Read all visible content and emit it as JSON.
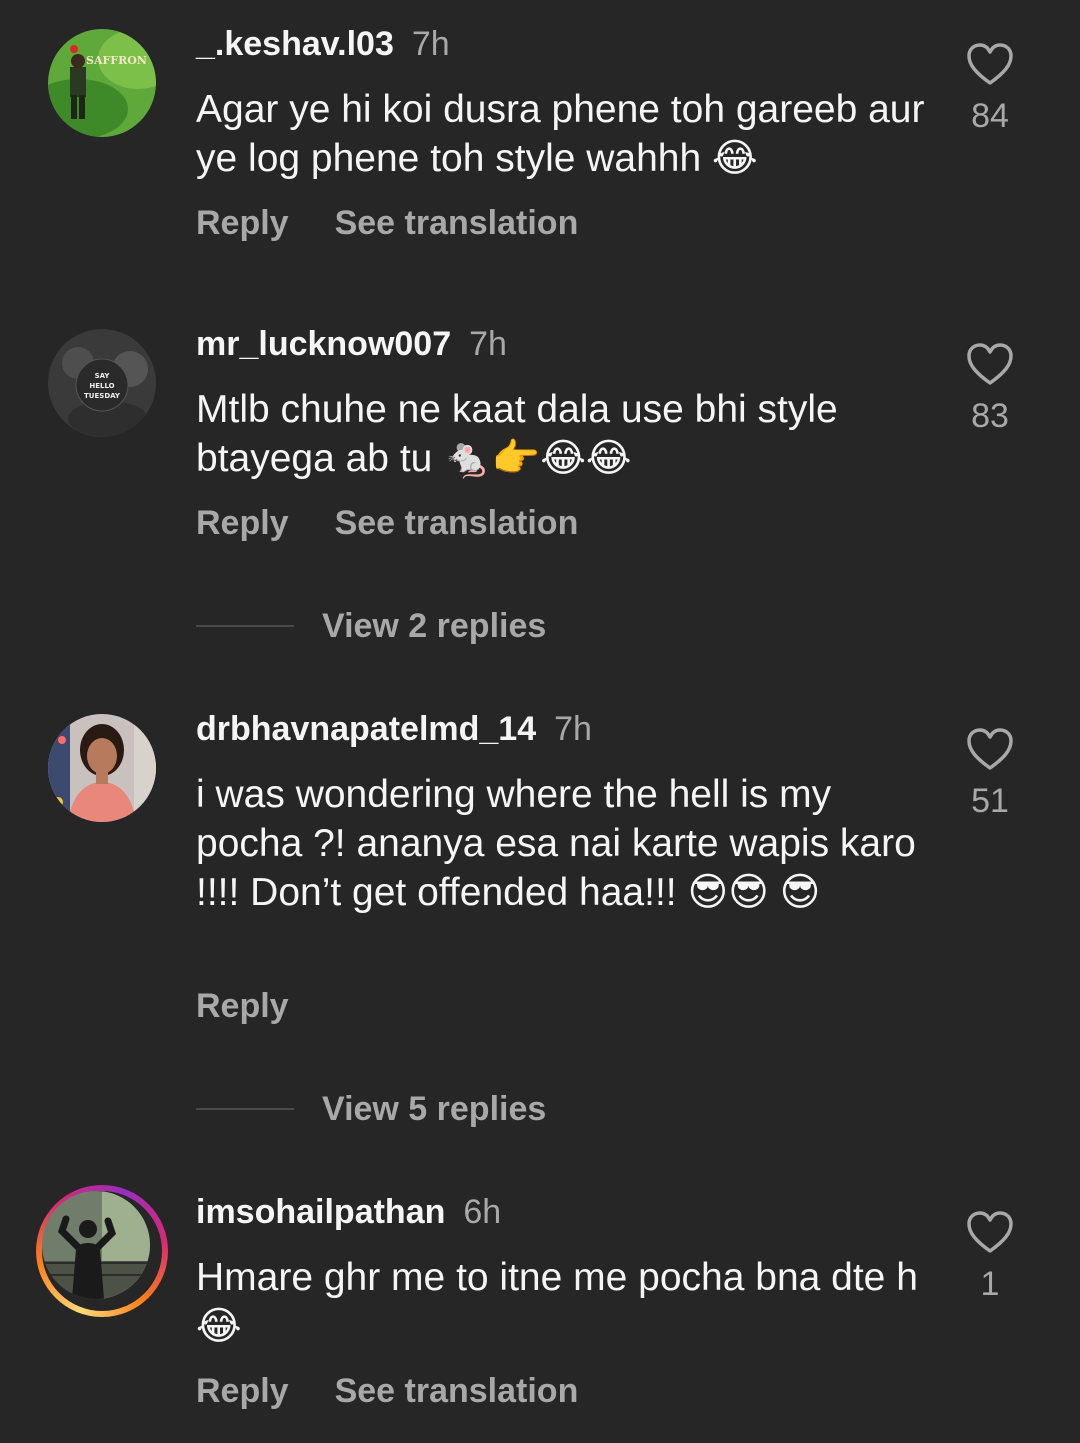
{
  "comments": [
    {
      "username": "_.keshav.l03",
      "time": "7h",
      "avatar": "saffron-field-avatar",
      "avatar_text": "SAFFRON",
      "text": "Agar ye hi koi dusra phene toh gareeb aur ye log phene toh style wahhh 😂",
      "reply": "Reply",
      "translate": "See translation",
      "likes": "84"
    },
    {
      "username": "mr_lucknow007",
      "time": "7h",
      "avatar": "say-hello-tuesday-avatar",
      "avatar_text": "SAY HELLO TUESDAY",
      "text": "Mtlb chuhe ne kaat dala use bhi style btayega ab tu 🐁👉😂😂",
      "reply": "Reply",
      "translate": "See translation",
      "likes": "83",
      "view_replies": "View 2 replies"
    },
    {
      "username": "drbhavnapatelmd_14",
      "time": "7h",
      "avatar": "woman-portrait-avatar",
      "text": "i was wondering where the hell is my pocha ?! ananya esa nai karte wapis karo !!!! Don’t get offended haa!!! 😎😎 😎",
      "reply": "Reply",
      "likes": "51",
      "view_replies": "View 5 replies"
    },
    {
      "username": "imsohailpathan",
      "time": "6h",
      "avatar": "silhouette-avatar",
      "text": "Hmare ghr me to itne me pocha bna dte h😂",
      "reply": "Reply",
      "translate": "See translation",
      "likes": "1"
    }
  ],
  "colors": {
    "background": "#262626",
    "primary_text": "#f5f5f5",
    "secondary_text": "#a8a8a8"
  },
  "icons": {
    "like": "heart-outline-icon"
  }
}
